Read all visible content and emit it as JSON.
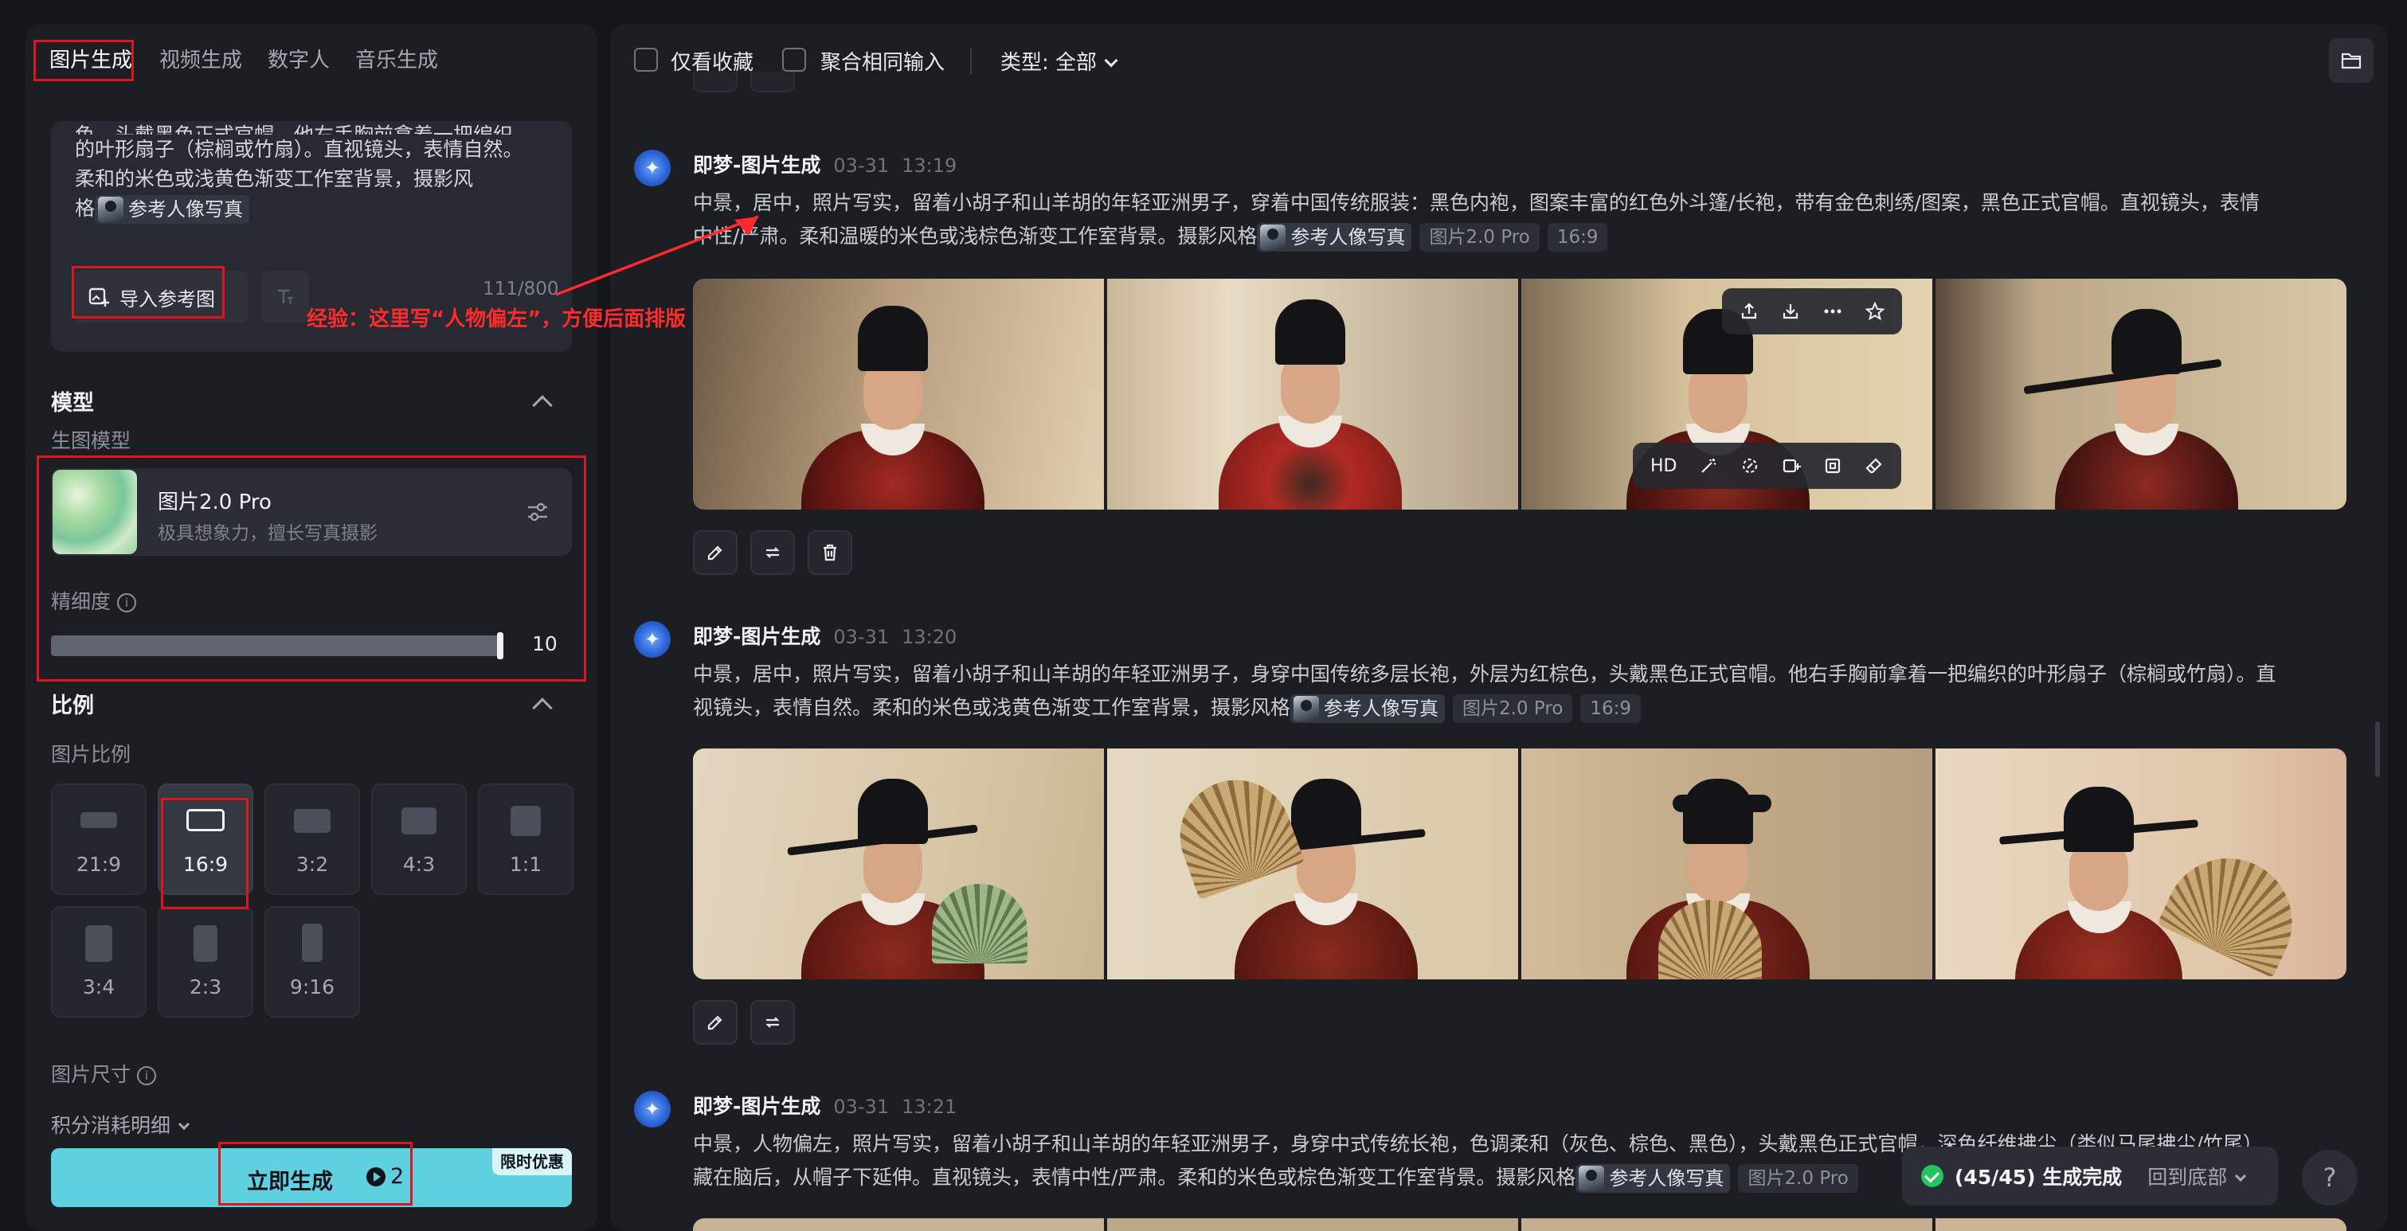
{
  "left_tabs": [
    "图片生成",
    "视频生成",
    "数字人",
    "音乐生成"
  ],
  "prompt": {
    "line0": "色，头戴黑色正式官帽。他右手胸前拿着一把编织",
    "line1": "的叶形扇子（棕榈或竹扇）。直视镜头，表情自然。",
    "line2": "柔和的米色或浅黄色渐变工作室背景，摄影风",
    "line3_prefix": "格",
    "ref_chip": "参考人像写真",
    "counter": "111/800",
    "import_label": "导入参考图"
  },
  "annotation": "经验：这里写“人物偏左”，方便后面排版",
  "model_section": {
    "title": "模型",
    "sub": "生图模型",
    "name": "图片2.0 Pro",
    "desc": "极具想象力，擅长写真摄影",
    "detail_label": "精细度",
    "detail_value": "10",
    "detail_fraction": 1.0
  },
  "ratio_section": {
    "title": "比例",
    "sub": "图片比例",
    "options": [
      "21:9",
      "16:9",
      "3:2",
      "4:3",
      "1:1",
      "3:4",
      "2:3",
      "9:16"
    ],
    "selected": "16:9",
    "size_label": "图片尺寸",
    "cost_label": "积分消耗明细"
  },
  "generate": {
    "label": "立即生成",
    "cost": "2",
    "promo": "限时优惠"
  },
  "topbar": {
    "fav_only": "仅看收藏",
    "merge_same": "聚合相同输入",
    "type_label": "类型: 全部"
  },
  "entries": [
    {
      "name": "即梦-图片生成",
      "date": "03-31",
      "time": "13:19",
      "text1": "中景，居中，照片写实，留着小胡子和山羊胡的年轻亚洲男子，穿着中国传统服装：黑色内袍，图案丰富的红色外斗篷/长袍，带有金色刺绣/图案，黑色正式官帽。直视镜头，表情",
      "text2": "中性/严肃。柔和温暖的米色或浅棕色渐变工作室背景。摄影风格",
      "ref": "参考人像写真",
      "model_tag": "图片2.0 Pro",
      "ratio_tag": "16:9"
    },
    {
      "name": "即梦-图片生成",
      "date": "03-31",
      "time": "13:20",
      "text1": "中景，居中，照片写实，留着小胡子和山羊胡的年轻亚洲男子，身穿中国传统多层长袍，外层为红棕色，头戴黑色正式官帽。他右手胸前拿着一把编织的叶形扇子（棕榈或竹扇）。直",
      "text2": "视镜头，表情自然。柔和的米色或浅黄色渐变工作室背景，摄影风格",
      "ref": "参考人像写真",
      "model_tag": "图片2.0 Pro",
      "ratio_tag": "16:9"
    },
    {
      "name": "即梦-图片生成",
      "date": "03-31",
      "time": "13:21",
      "text1": "中景，人物偏左，照片写实，留着小胡子和山羊胡的年轻亚洲男子，身穿中式传统长袍，色调柔和（灰色、棕色、黑色），头戴黑色正式官帽，深色纤维拂尘（类似马尾拂尘/竹尾）",
      "text2": "藏在脑后，从帽子下延伸。直视镜头，表情中性/严肃。柔和的米色或棕色渐变工作室背景。摄影风格",
      "ref": "参考人像写真",
      "model_tag": "图片2.0 Pro"
    }
  ],
  "hover_tools": {
    "hd": "HD"
  },
  "toast": {
    "message": "(45/45) 生成完成",
    "back": "回到底部"
  },
  "help": "?"
}
